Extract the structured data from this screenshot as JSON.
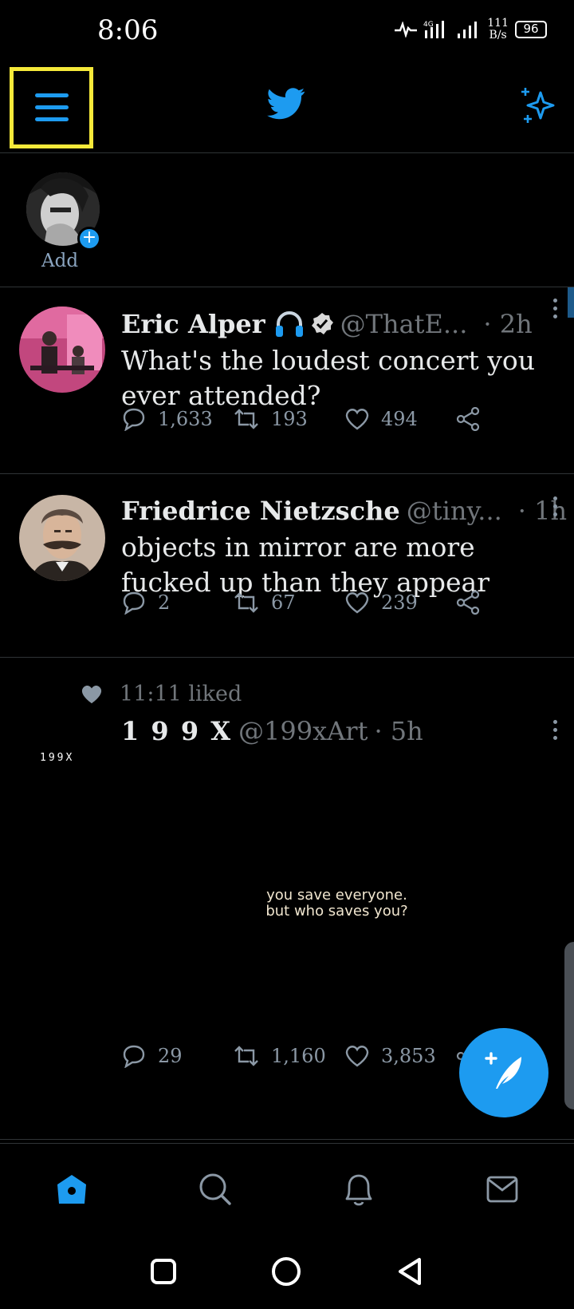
{
  "status_bar": {
    "time": "8:06",
    "net_speed_value": "111",
    "net_speed_unit": "B/s",
    "battery": "96"
  },
  "top_bar": {
    "menu_icon": "hamburger-menu-icon",
    "logo_icon": "twitter-bird-icon",
    "sparkle_icon": "sparkle-icon",
    "accent_color": "#1d9bf0",
    "highlight_color": "#f5e93a"
  },
  "fleets": {
    "add_label": "Add"
  },
  "tweets": [
    {
      "author": "Eric Alper",
      "emoji_icon": "headphones-icon",
      "verified_icon": "verified-badge-icon",
      "handle": "@ThatE...",
      "time": "· 2h",
      "text": "What's the loudest concert you ever attended?",
      "replies": "1,633",
      "retweets": "193",
      "likes": "494"
    },
    {
      "author": "Friedrice Nietzsche",
      "handle": "@tiny...",
      "time": "· 1h",
      "text": "objects in mirror are more fucked up than they appear",
      "replies": "2",
      "retweets": "67",
      "likes": "239"
    },
    {
      "liked_by": "11:11 liked",
      "author": "1 9 9 X",
      "handle": "@199xArt",
      "time": "· 5h",
      "avatar_text": "199X",
      "image_caption_line1": "you save everyone.",
      "image_caption_line2": "but who saves you?",
      "replies": "29",
      "retweets": "1,160",
      "likes": "3,853"
    }
  ],
  "bottom_nav": {
    "items": [
      "home-icon",
      "search-icon",
      "notifications-bell-icon",
      "messages-mail-icon"
    ],
    "active": "home-icon"
  },
  "system_nav": [
    "recents-square-icon",
    "home-circle-icon",
    "back-triangle-icon"
  ]
}
